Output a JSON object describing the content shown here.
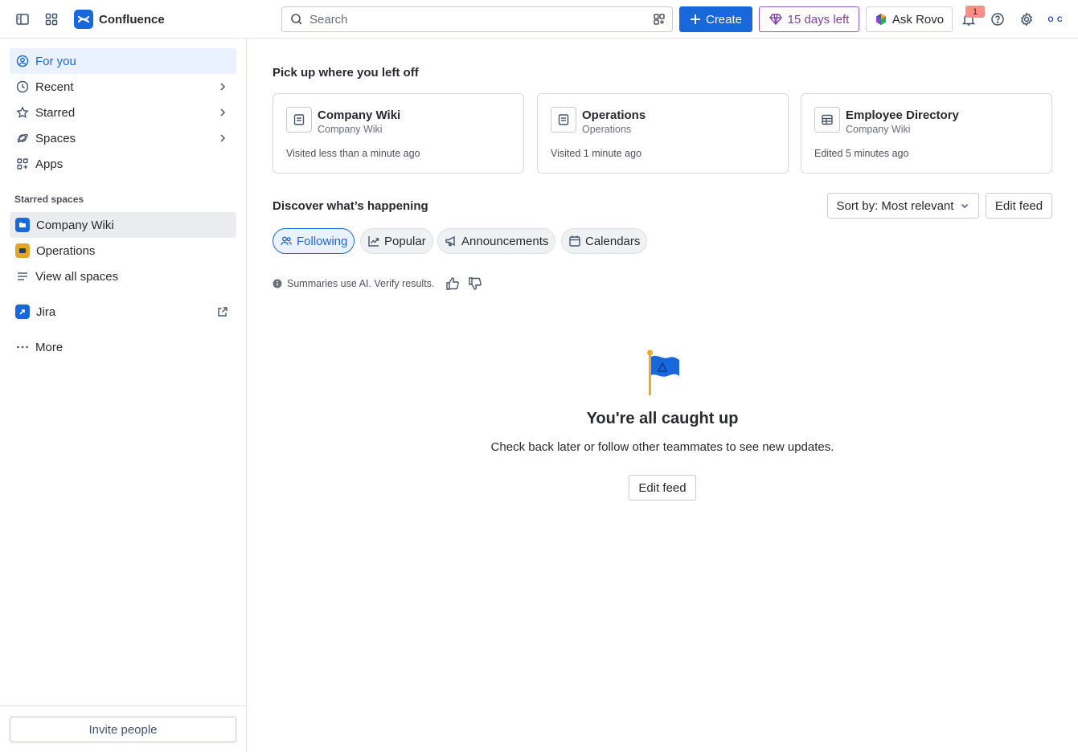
{
  "topbar": {
    "app_name": "Confluence",
    "search_placeholder": "Search",
    "create_label": "Create",
    "trial_label": "15 days left",
    "rovo_label": "Ask Rovo",
    "notification_count": "1",
    "avatar_initials": "O C",
    "brand_color": "#1868db"
  },
  "sidebar": {
    "items": [
      {
        "label": "For you",
        "icon": "user-circle-icon"
      },
      {
        "label": "Recent",
        "icon": "clock-icon"
      },
      {
        "label": "Starred",
        "icon": "star-icon"
      },
      {
        "label": "Spaces",
        "icon": "planet-icon"
      },
      {
        "label": "Apps",
        "icon": "apps-icon"
      }
    ],
    "starred_spaces_label": "Starred spaces",
    "spaces": [
      {
        "label": "Company Wiki"
      },
      {
        "label": "Operations"
      }
    ],
    "view_all_label": "View all spaces",
    "jira_label": "Jira",
    "more_label": "More",
    "invite_label": "Invite people"
  },
  "main": {
    "recent_heading": "Pick up where you left off",
    "cards": [
      {
        "title": "Company Wiki",
        "subtitle": "Company Wiki",
        "meta": "Visited less than a minute ago",
        "icon": "page-icon"
      },
      {
        "title": "Operations",
        "subtitle": "Operations",
        "meta": "Visited 1 minute ago",
        "icon": "page-icon"
      },
      {
        "title": "Employee Directory",
        "subtitle": "Company Wiki",
        "meta": "Edited 5 minutes ago",
        "icon": "database-icon"
      }
    ],
    "discover_heading": "Discover what’s happening",
    "sort_label": "Sort by: Most relevant",
    "edit_feed_label": "Edit feed",
    "tabs": [
      {
        "label": "Following"
      },
      {
        "label": "Popular"
      },
      {
        "label": "Announcements"
      },
      {
        "label": "Calendars"
      }
    ],
    "ai_note": "Summaries use AI. Verify results.",
    "empty_title": "You're all caught up",
    "empty_subtitle": "Check back later or follow other teammates to see new updates.",
    "empty_button": "Edit feed"
  }
}
